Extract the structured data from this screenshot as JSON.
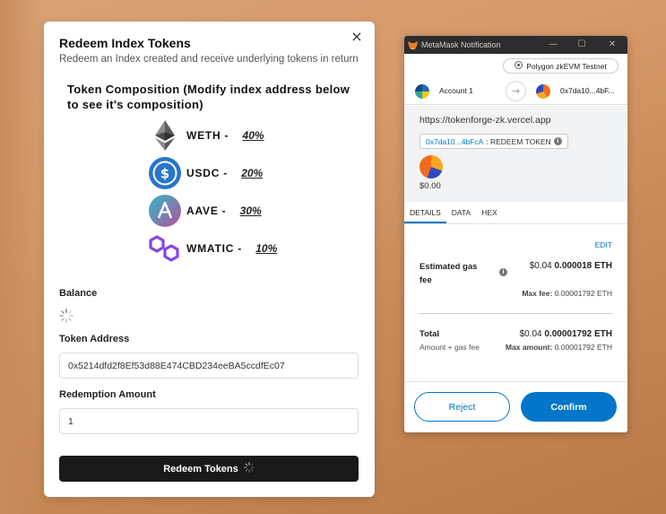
{
  "redeem_modal": {
    "title": "Redeem Index Tokens",
    "subtitle": "Redeem an Index created and receive underlying tokens in return",
    "close_label": "×",
    "composition_heading": "Token Composition (Modify index address below to see it's composition)",
    "tokens": [
      {
        "name": "WETH",
        "separator": "-",
        "percent": "40%",
        "icon": "ethereum-icon"
      },
      {
        "name": "USDC",
        "separator": "-",
        "percent": "20%",
        "icon": "usdc-icon"
      },
      {
        "name": "AAVE",
        "separator": "-",
        "percent": "30%",
        "icon": "aave-icon"
      },
      {
        "name": "WMATIC",
        "separator": "-",
        "percent": "10%",
        "icon": "polygon-icon"
      }
    ],
    "balance_label": "Balance",
    "token_address_label": "Token Address",
    "token_address_value": "0x5214dfd2f8Ef53d88E474CBD234eeBA5ccdfEc07",
    "redemption_amount_label": "Redemption Amount",
    "redemption_amount_value": "1",
    "redeem_button_label": "Redeem Tokens"
  },
  "metamask": {
    "window_title": "MetaMask Notification",
    "window_controls": {
      "minimize": "—",
      "maximize": "☐",
      "close": "✕"
    },
    "network": "Polygon zkEVM Testnet",
    "from_account": "Account 1",
    "to_account": "0x7da10...4bF...",
    "origin_url": "https://tokenforge-zk.vercel.app",
    "contract_address": "0x7da10...4bFcA",
    "contract_method": ": REDEEM TOKEN",
    "value": "$0.00",
    "tabs": [
      "DETAILS",
      "DATA",
      "HEX"
    ],
    "active_tab": "DETAILS",
    "edit_label": "EDIT",
    "gas": {
      "label": "Estimated gas fee",
      "fiat": "$0.04",
      "eth": "0.000018 ETH",
      "max_label": "Max fee:",
      "max_value": "0.00001792 ETH"
    },
    "total": {
      "label": "Total",
      "sub_label": "Amount + gas fee",
      "fiat": "$0.04",
      "eth": "0.00001792 ETH",
      "max_label": "Max amount:",
      "max_value": "0.00001792 ETH"
    },
    "reject_label": "Reject",
    "confirm_label": "Confirm"
  },
  "colors": {
    "metamask_blue": "#0376c9",
    "redeem_button": "#1a1a1a",
    "titlebar": "#2d2d30"
  }
}
